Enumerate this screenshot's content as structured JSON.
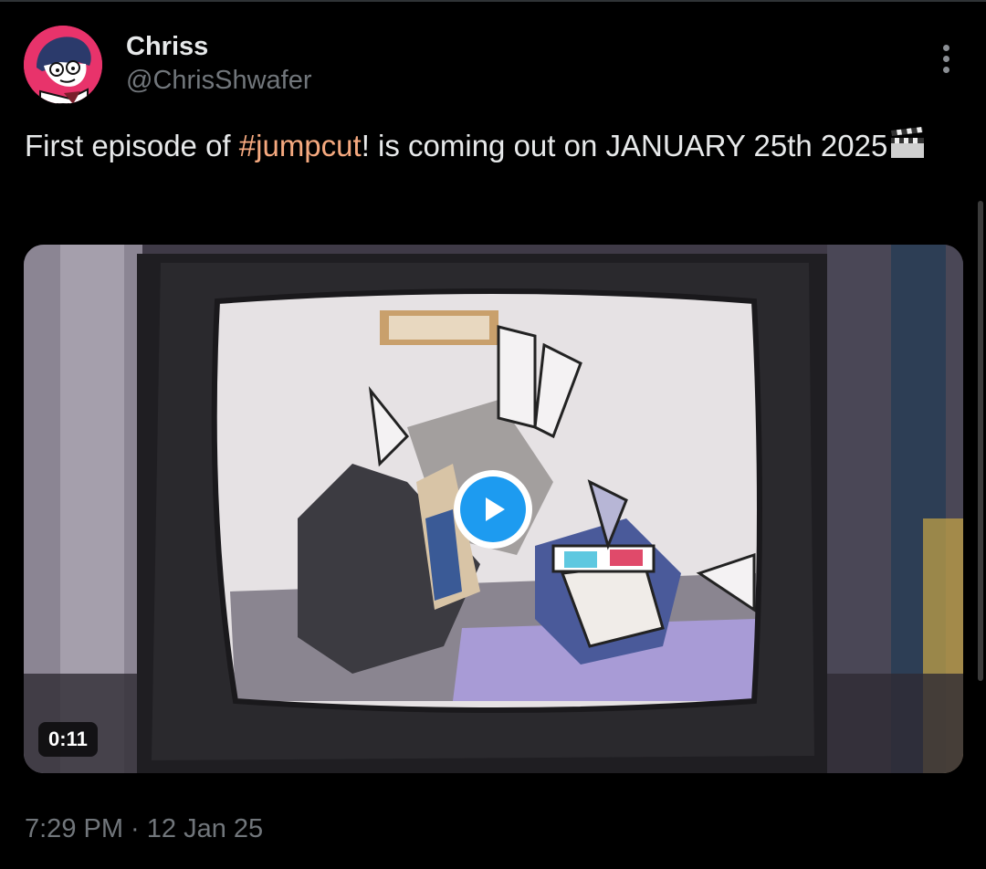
{
  "author": {
    "display_name": "Chriss",
    "handle": "@ChrisShwafer",
    "avatar_icon": "cartoon-avatar",
    "avatar_color": "#e8336b"
  },
  "tweet": {
    "text_before": "First episode of ",
    "hashtag": "#jumpcut",
    "text_after": "! is coming out on JANUARY 25th 2025",
    "emoji_icon": "clapper-board-icon",
    "hashtag_color": "#f5a97f"
  },
  "media": {
    "type": "video",
    "duration": "0:11",
    "play_icon": "play-icon",
    "play_color": "#1d9bf0"
  },
  "timestamp": "7:29 PM · 12 Jan 25",
  "more_icon": "more-vertical-icon"
}
